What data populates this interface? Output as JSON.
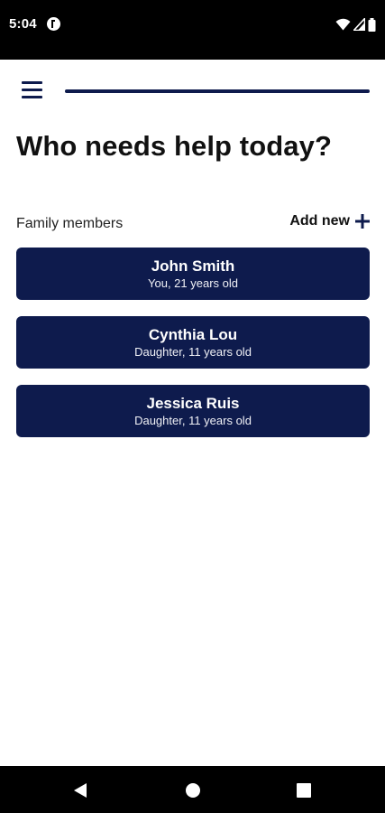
{
  "status_bar": {
    "time": "5:04",
    "app_icon": "app-notification-icon",
    "icons": [
      "wifi-icon",
      "cell-signal-icon",
      "battery-icon"
    ]
  },
  "header": {
    "menu_icon": "hamburger-menu-icon",
    "progress_fraction": 1.0
  },
  "main": {
    "title": "Who needs help today?",
    "section_label": "Family members",
    "add_new_label": "Add new",
    "add_icon": "plus-icon",
    "members": [
      {
        "name": "John Smith",
        "description": "You, 21 years old"
      },
      {
        "name": "Cynthia Lou",
        "description": "Daughter, 11 years old"
      },
      {
        "name": "Jessica Ruis",
        "description": "Daughter, 11 years old"
      }
    ]
  },
  "nav_bar": {
    "buttons": [
      "back-icon",
      "home-icon",
      "recents-icon"
    ]
  },
  "colors": {
    "primary": "#0e1b4d",
    "text": "#111111",
    "background": "#ffffff"
  }
}
